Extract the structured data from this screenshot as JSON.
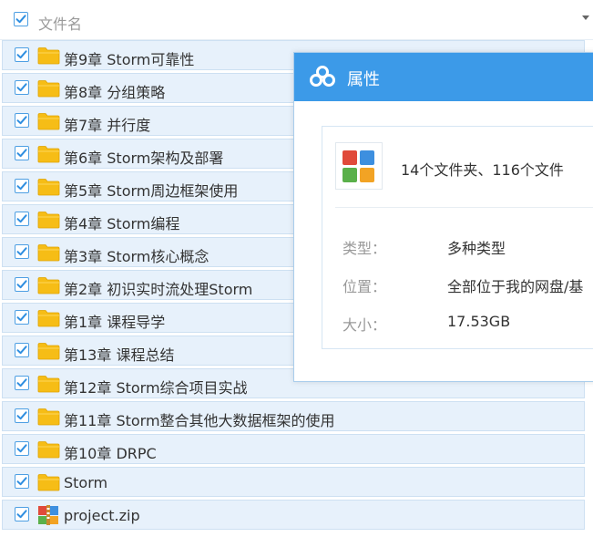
{
  "header": {
    "column_label": "文件名"
  },
  "files": [
    {
      "name": "第9章 Storm可靠性",
      "type": "folder"
    },
    {
      "name": "第8章 分组策略",
      "type": "folder"
    },
    {
      "name": "第7章 并行度",
      "type": "folder"
    },
    {
      "name": "第6章 Storm架构及部署",
      "type": "folder"
    },
    {
      "name": "第5章 Storm周边框架使用",
      "type": "folder"
    },
    {
      "name": "第4章 Storm编程",
      "type": "folder"
    },
    {
      "name": "第3章 Storm核心概念",
      "type": "folder"
    },
    {
      "name": "第2章 初识实时流处理Storm",
      "type": "folder"
    },
    {
      "name": "第1章 课程导学",
      "type": "folder"
    },
    {
      "name": "第13章 课程总结",
      "type": "folder"
    },
    {
      "name": "第12章 Storm综合项目实战",
      "type": "folder"
    },
    {
      "name": "第11章 Storm整合其他大数据框架的使用",
      "type": "folder"
    },
    {
      "name": "第10章 DRPC",
      "type": "folder"
    },
    {
      "name": "Storm",
      "type": "folder"
    },
    {
      "name": "project.zip",
      "type": "zip"
    }
  ],
  "dialog": {
    "title": "属性",
    "summary": "14个文件夹、116个文件",
    "type_label": "类型：",
    "type_value": "多种类型",
    "location_label": "位置：",
    "location_value": "全部位于我的网盘/基",
    "size_label": "大小：",
    "size_value": "17.53GB"
  },
  "colors": {
    "accent": "#3c9ae8",
    "row_bg": "#e7f1fb",
    "folder": "#f5b800"
  },
  "icons": {
    "checkbox": "checkbox-checked-icon",
    "folder": "folder-icon",
    "zip": "zip-archive-icon",
    "cloud": "cloud-icon",
    "app": "multi-type-icon",
    "dropdown": "dropdown-arrow-icon"
  }
}
